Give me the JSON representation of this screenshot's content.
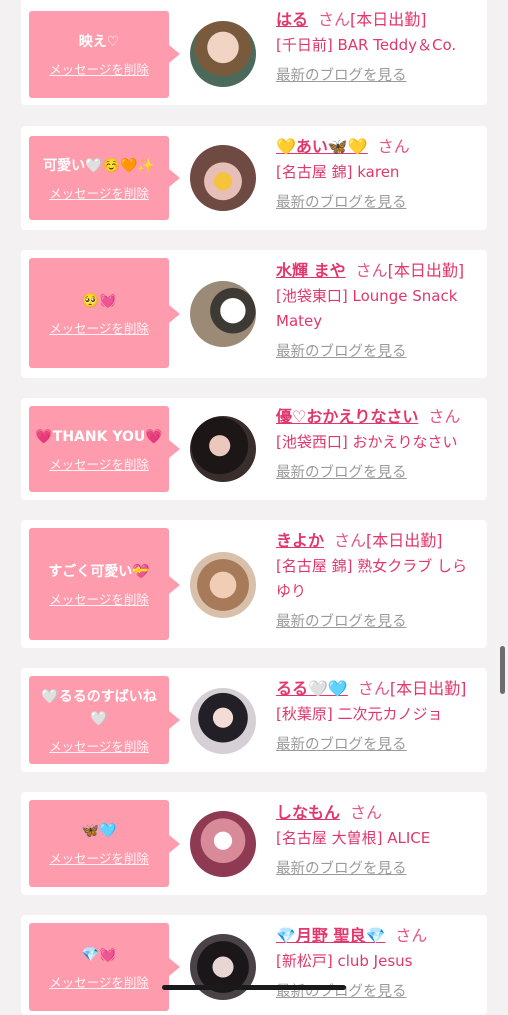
{
  "cards": [
    {
      "message": "映え♡",
      "delete_label": "メッセージを削除",
      "name": "はる",
      "san": "さん",
      "status": "[本日出勤]",
      "shop": "[千日前] BAR Teddy＆Co.",
      "blog_label": "最新のブログを見る",
      "avatar_color": "#5a6b5e"
    },
    {
      "message": "可愛い🤍☺️🧡✨",
      "delete_label": "メッセージを削除",
      "name": "💛あい🦋💛",
      "san": "さん",
      "status": "",
      "shop": "[名古屋 錦] karen",
      "blog_label": "最新のブログを見る",
      "avatar_color": "#b7898b"
    },
    {
      "message": "🥺💓",
      "delete_label": "メッセージを削除",
      "name": "水輝 まや",
      "san": "さん",
      "status": "[本日出勤]",
      "shop": "[池袋東口] Lounge Snack Matey",
      "blog_label": "最新のブログを見る",
      "avatar_color": "#5d554d"
    },
    {
      "message": "💗THANK YOU💗",
      "delete_label": "メッセージを削除",
      "name": "優♡おかえりなさい",
      "san": "さん",
      "status": "",
      "shop": "[池袋西口] おかえりなさい",
      "blog_label": "最新のブログを見る",
      "avatar_color": "#2c2424"
    },
    {
      "message": "すごく可愛い💝",
      "delete_label": "メッセージを削除",
      "name": "きよか",
      "san": "さん",
      "status": "[本日出勤]",
      "shop": "[名古屋 錦] 熟女クラブ しらゆり",
      "blog_label": "最新のブログを見る",
      "avatar_color": "#c69a82"
    },
    {
      "message": "🤍るるのすばいね🤍",
      "delete_label": "メッセージを削除",
      "name": "るる🤍🩵",
      "san": "さん",
      "status": "[本日出勤]",
      "shop": "[秋葉原] 二次元カノジョ",
      "blog_label": "最新のブログを見る",
      "avatar_color": "#3a3340"
    },
    {
      "message": "🦋🩵",
      "delete_label": "メッセージを削除",
      "name": "しなもん",
      "san": "さん",
      "status": "",
      "shop": "[名古屋 大曽根] ALICE",
      "blog_label": "最新のブログを見る",
      "avatar_color": "#b0546c"
    },
    {
      "message": "💎💓",
      "delete_label": "メッセージを削除",
      "name": "💎月野 聖良💎",
      "san": "さん",
      "status": "",
      "shop": "[新松戸] club Jesus",
      "blog_label": "最新のブログを見る",
      "avatar_color": "#2a2228"
    }
  ]
}
